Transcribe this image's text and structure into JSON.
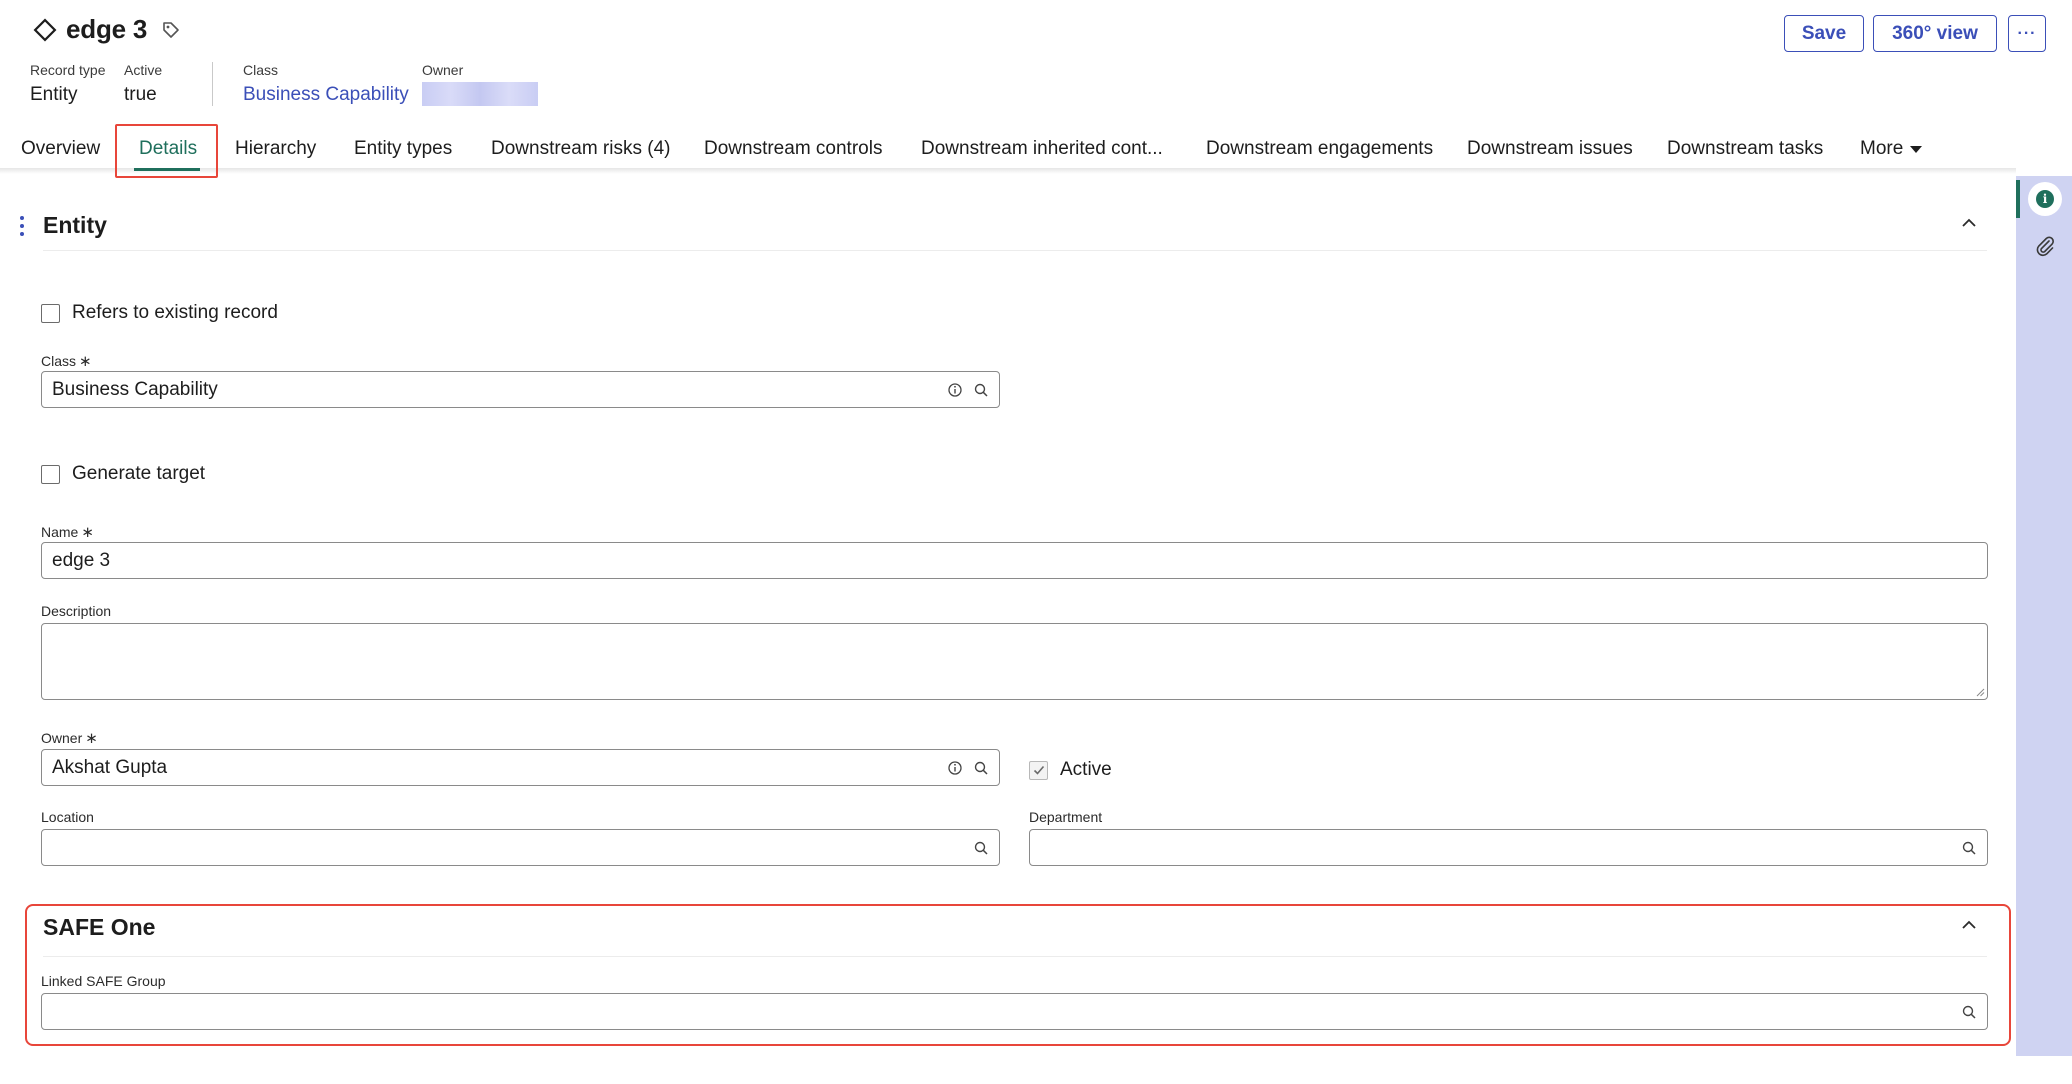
{
  "header": {
    "title": "edge 3",
    "meta": {
      "record_type_label": "Record type",
      "record_type_value": "Entity",
      "active_label": "Active",
      "active_value": "true",
      "class_label": "Class",
      "class_value": "Business Capability",
      "owner_label": "Owner"
    },
    "buttons": {
      "save": "Save",
      "view360": "360° view",
      "more": "···"
    }
  },
  "tabs": [
    {
      "label": "Overview"
    },
    {
      "label": "Details",
      "active": true
    },
    {
      "label": "Hierarchy"
    },
    {
      "label": "Entity types"
    },
    {
      "label": "Downstream risks (4)"
    },
    {
      "label": "Downstream controls"
    },
    {
      "label": "Downstream inherited cont..."
    },
    {
      "label": "Downstream engagements"
    },
    {
      "label": "Downstream issues"
    },
    {
      "label": "Downstream tasks"
    },
    {
      "label": "More"
    }
  ],
  "entity_section": {
    "title": "Entity",
    "refers_existing_label": "Refers to existing record",
    "class_label": "Class",
    "class_value": "Business Capability",
    "generate_target_label": "Generate target",
    "name_label": "Name",
    "name_value": "edge 3",
    "description_label": "Description",
    "description_value": "",
    "owner_label": "Owner",
    "owner_value": "Akshat Gupta",
    "active_label": "Active",
    "active_checked": true,
    "location_label": "Location",
    "location_value": "",
    "department_label": "Department",
    "department_value": "",
    "required_mark": "∗"
  },
  "safe_section": {
    "title": "SAFE One",
    "linked_group_label": "Linked SAFE Group",
    "linked_group_value": ""
  },
  "colors": {
    "accent": "#3b4fb8",
    "active_tab": "#1f6f5c",
    "highlight": "#e8463a",
    "rail": "#cfd3f2"
  }
}
